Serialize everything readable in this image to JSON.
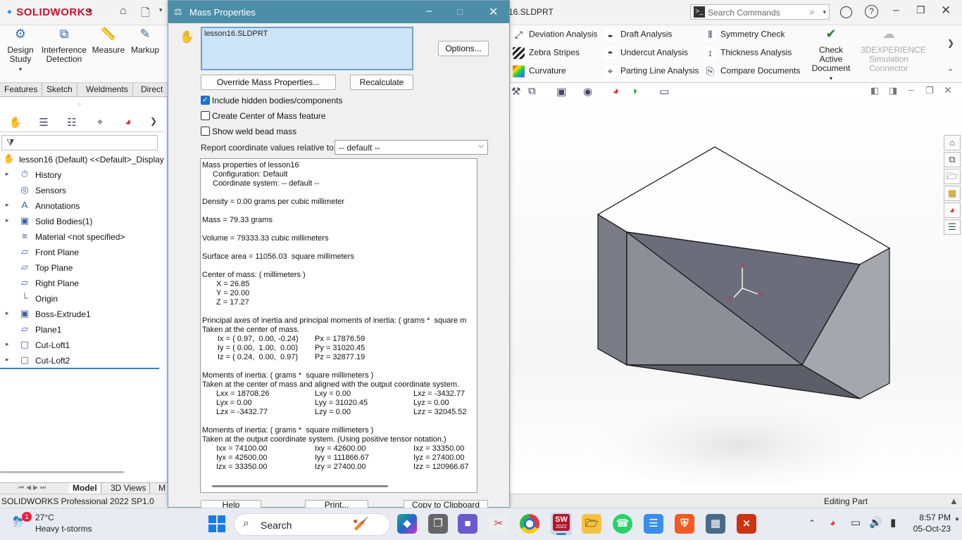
{
  "app": {
    "logo_brand": "SOLID",
    "logo_suffix": "WORKS",
    "file_title": "16.SLDPRT",
    "search_placeholder": "Search Commands"
  },
  "ribbon": {
    "left_buttons": [
      {
        "icon": "design-study-icon",
        "label1": "Design",
        "label2": "Study"
      },
      {
        "icon": "interference-detection-icon",
        "label1": "Interference",
        "label2": "Detection"
      },
      {
        "icon": "measure-icon",
        "label1": "Measure",
        "label2": ""
      },
      {
        "icon": "markup-icon",
        "label1": "Markup",
        "label2": ""
      }
    ],
    "right_col1": [
      "Deviation Analysis",
      "Zebra Stripes",
      "Curvature"
    ],
    "right_col2": [
      "Draft Analysis",
      "Undercut Analysis",
      "Parting Line Analysis"
    ],
    "right_col3": [
      "Symmetry Check",
      "Thickness Analysis",
      "Compare Documents"
    ],
    "check_active_1": "Check Active",
    "check_active_2": "Document",
    "exp_1": "3DEXPERIENCE",
    "exp_2": "Simulation",
    "exp_3": "Connector"
  },
  "cmd_tabs": [
    "Features",
    "Sketch",
    "Weldments",
    "Direct E"
  ],
  "tree": {
    "root": "lesson16 (Default) <<Default>_Display",
    "items": [
      {
        "label": "History",
        "expandable": true,
        "icon": "history-icon"
      },
      {
        "label": "Sensors",
        "expandable": false,
        "icon": "sensors-icon"
      },
      {
        "label": "Annotations",
        "expandable": true,
        "icon": "annotations-icon"
      },
      {
        "label": "Solid Bodies(1)",
        "expandable": true,
        "icon": "solid-bodies-icon"
      },
      {
        "label": "Material <not specified>",
        "expandable": false,
        "icon": "material-icon"
      },
      {
        "label": "Front Plane",
        "expandable": false,
        "icon": "plane-icon"
      },
      {
        "label": "Top Plane",
        "expandable": false,
        "icon": "plane-icon"
      },
      {
        "label": "Right Plane",
        "expandable": false,
        "icon": "plane-icon"
      },
      {
        "label": "Origin",
        "expandable": false,
        "icon": "origin-icon"
      },
      {
        "label": "Boss-Extrude1",
        "expandable": true,
        "icon": "extrude-icon"
      },
      {
        "label": "Plane1",
        "expandable": false,
        "icon": "plane-icon"
      },
      {
        "label": "Cut-Loft1",
        "expandable": true,
        "icon": "cut-loft-icon"
      },
      {
        "label": "Cut-Loft2",
        "expandable": true,
        "icon": "cut-loft-icon"
      }
    ]
  },
  "bottom_tabs": [
    "Model",
    "3D Views",
    "M"
  ],
  "status": {
    "left": "SOLIDWORKS Professional 2022 SP1.0",
    "right": "Editing Part"
  },
  "dialog": {
    "title": "Mass Properties",
    "selected_file": "lesson16.SLDPRT",
    "options_btn": "Options...",
    "override_btn": "Override Mass Properties...",
    "recalc_btn": "Recalculate",
    "chk_hidden": "Include hidden bodies/components",
    "chk_com": "Create Center of Mass feature",
    "chk_weld": "Show weld bead mass",
    "report_label": "Report coordinate values relative to:",
    "report_value": "-- default --",
    "help_btn": "Help",
    "print_btn": "Print...",
    "copy_btn": "Copy to Clipboard",
    "results": {
      "header": "Mass properties of lesson16",
      "config": "Configuration: Default",
      "coordsys": "Coordinate system: -- default --",
      "density": "Density = 0.00 grams per cubic millimeter",
      "mass": "Mass = 79.33 grams",
      "volume": "Volume = 79333.33 cubic millimeters",
      "surface": "Surface area = 11056.03  square millimeters",
      "com_head": "Center of mass: ( millimeters )",
      "com_x": "X = 26.85",
      "com_y": "Y = 20.00",
      "com_z": "Z = 17.27",
      "pa_head": "Principal axes of inertia and principal moments of inertia: ( grams *  square m",
      "pa_sub": "Taken at the center of mass.",
      "ix": "Ix = ( 0.97,  0.00, -0.24)",
      "iy": "Iy = ( 0.00,  1.00,  0.00)",
      "iz": "Iz = ( 0.24,  0.00,  0.97)",
      "px": "Px = 17876.59",
      "py": "Py = 31020.45",
      "pz": "Pz = 32877.19",
      "moi1_head": "Moments of inertia: ( grams *  square millimeters )",
      "moi1_sub": "Taken at the center of mass and aligned with the output coordinate system.",
      "l_rows": [
        [
          "Lxx = 18708.26",
          "Lxy = 0.00",
          "Lxz = -3432.77"
        ],
        [
          "Lyx = 0.00",
          "Lyy = 31020.45",
          "Lyz = 0.00"
        ],
        [
          "Lzx = -3432.77",
          "Lzy = 0.00",
          "Lzz = 32045.52"
        ]
      ],
      "moi2_head": "Moments of inertia: ( grams *  square millimeters )",
      "moi2_sub": "Taken at the output coordinate system. (Using positive tensor notation.)",
      "i_rows": [
        [
          "Ixx = 74100.00",
          "Ixy = 42600.00",
          "Ixz = 33350.00"
        ],
        [
          "Iyx = 42600.00",
          "Iyy = 111866.67",
          "Iyz = 27400.00"
        ],
        [
          "Izx = 33350.00",
          "Izy = 27400.00",
          "Izz = 120966.67"
        ]
      ]
    }
  },
  "taskbar": {
    "weather_temp": "27°C",
    "weather_desc": "Heavy t-storms",
    "weather_badge": "1",
    "search_label": "Search",
    "time": "8:57 PM",
    "date": "05-Oct-23",
    "sw_label": "2022"
  }
}
